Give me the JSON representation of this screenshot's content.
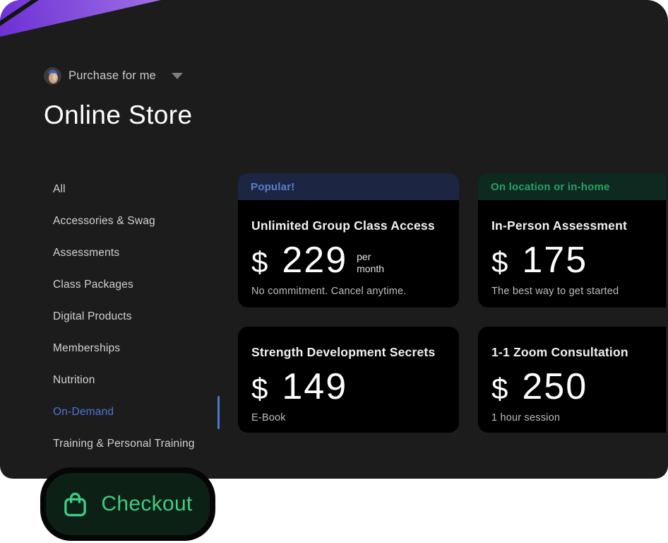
{
  "header": {
    "account_switcher_label": "Purchase for me",
    "page_title": "Online Store"
  },
  "sidebar": {
    "items": [
      {
        "label": "All",
        "active": false
      },
      {
        "label": "Accessories & Swag",
        "active": false
      },
      {
        "label": "Assessments",
        "active": false
      },
      {
        "label": "Class Packages",
        "active": false
      },
      {
        "label": "Digital Products",
        "active": false
      },
      {
        "label": "Memberships",
        "active": false
      },
      {
        "label": "Nutrition",
        "active": false
      },
      {
        "label": "On-Demand",
        "active": true
      },
      {
        "label": "Training & Personal Training",
        "active": false
      }
    ]
  },
  "products": [
    {
      "badge": "Popular!",
      "badge_theme": "blue",
      "title": "Unlimited Group Class Access",
      "currency": "$",
      "amount": "229",
      "per_line_1": "per",
      "per_line_2": "month",
      "subtext": "No commitment. Cancel anytime."
    },
    {
      "badge": "On location or in-home",
      "badge_theme": "green",
      "title": "In-Person Assessment",
      "currency": "$",
      "amount": "175",
      "subtext": "The best way to get started"
    },
    {
      "title": "Strength Development Secrets",
      "currency": "$",
      "amount": "149",
      "subtext": "E-Book"
    },
    {
      "title": "1-1 Zoom Consultation",
      "currency": "$",
      "amount": "250",
      "subtext": "1 hour session"
    }
  ],
  "checkout": {
    "label": "Checkout",
    "icon": "shopping-bag-icon"
  },
  "colors": {
    "panel_background": "#1c1c1c",
    "card_background": "#000000",
    "active_link_blue": "#4f74d4",
    "badge_blue_bg": "#1c2642",
    "badge_blue_text": "#5d7ec7",
    "badge_green_bg": "#0e2920",
    "badge_green_text": "#29a164",
    "checkout_green": "#3ecd85",
    "checkout_bg": "#0c2016",
    "decoration_purple_dark": "#6c2fd4",
    "decoration_purple_light": "#a678e8"
  }
}
